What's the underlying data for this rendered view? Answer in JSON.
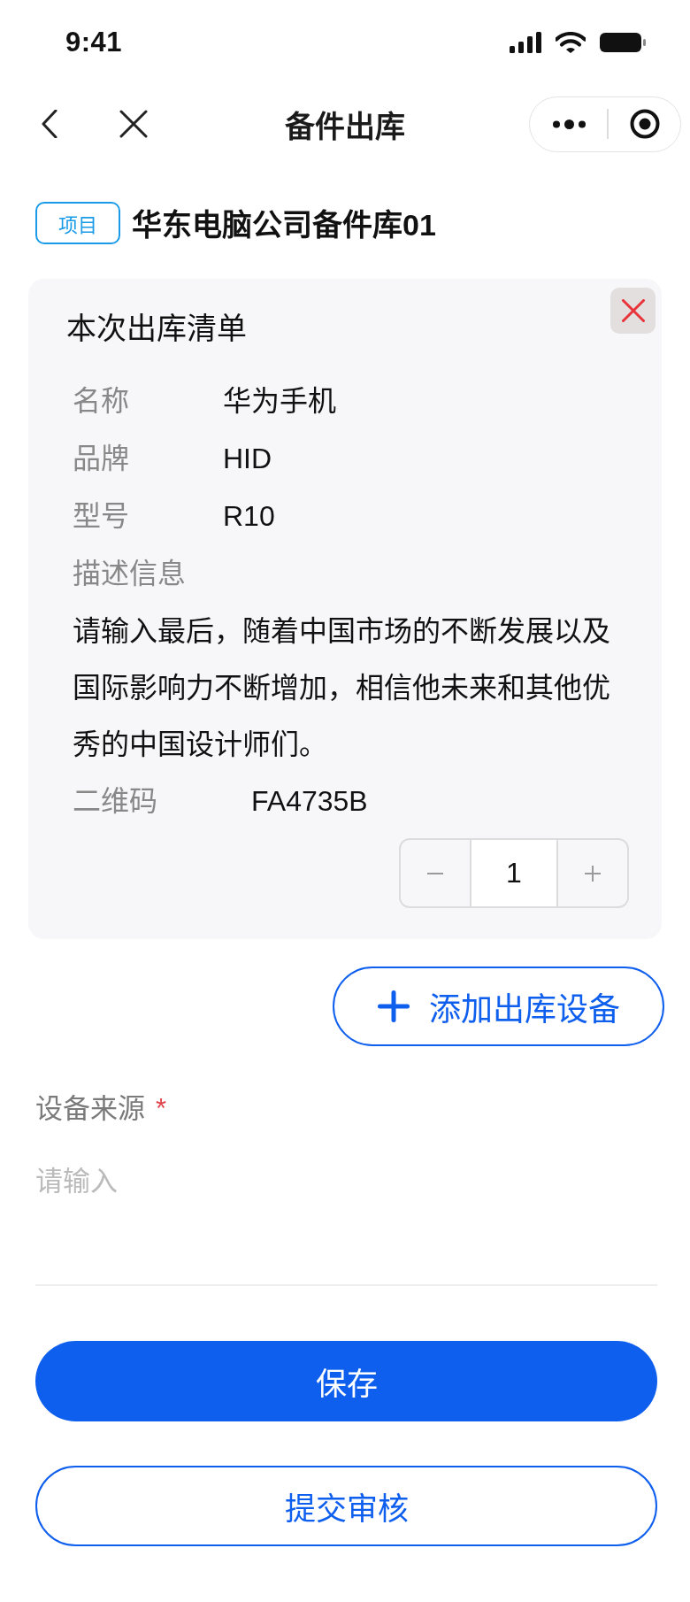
{
  "status_bar": {
    "time": "9:41"
  },
  "nav_bar": {
    "title": "备件出库"
  },
  "project": {
    "tag": "项目",
    "name": "华东电脑公司备件库01"
  },
  "outbound_list": {
    "title": "本次出库清单",
    "fields": [
      {
        "kind": "inline",
        "label": "名称",
        "value": "华为手机"
      },
      {
        "kind": "inline",
        "label": "品牌",
        "value": "HID"
      },
      {
        "kind": "inline",
        "label": "型号",
        "value": "R10"
      },
      {
        "kind": "block",
        "label": "描述信息",
        "value": "请输入最后，随着中国市场的不断发展以及国际影响力不断增加，相信他未来和其他优秀的中国设计师们。"
      },
      {
        "kind": "inline",
        "label": "二维码",
        "value": "FA4735B"
      }
    ],
    "quantity": "1"
  },
  "add_button": {
    "label": "添加出库设备"
  },
  "form": {
    "fields": [
      {
        "label": "设备来源",
        "required_mark": "*",
        "placeholder": "请输入"
      }
    ]
  },
  "buttons": [
    {
      "kind": "primary",
      "label": "保存"
    },
    {
      "kind": "outline",
      "label": "提交审核"
    }
  ]
}
